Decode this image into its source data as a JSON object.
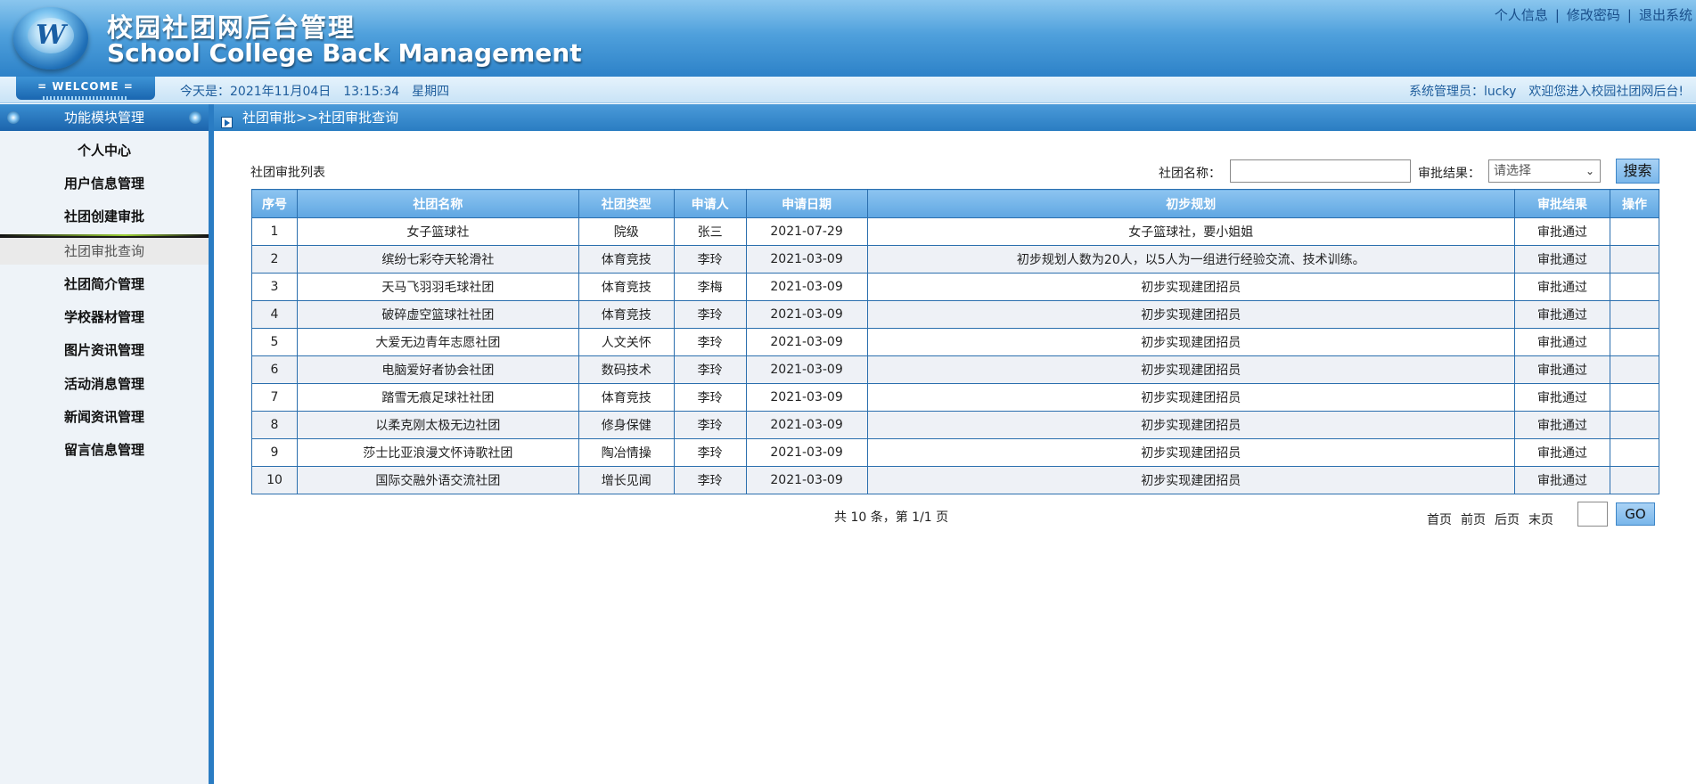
{
  "header": {
    "logo_letter": "W",
    "title_cn": "校园社团网后台管理",
    "title_en": "School College Back Management",
    "links": [
      "个人信息",
      "修改密码",
      "退出系统"
    ]
  },
  "infobar": {
    "welcome": "= WELCOME =",
    "date_label": "今天是：2021年11月04日",
    "time": "13:15:34",
    "weekday": "星期四",
    "admin": "系统管理员：lucky",
    "greeting": "欢迎您进入校园社团网后台!"
  },
  "sidebar": {
    "title": "功能模块管理",
    "items": [
      "个人中心",
      "用户信息管理",
      "社团创建审批",
      "社团审批查询",
      "社团简介管理",
      "学校器材管理",
      "图片资讯管理",
      "活动消息管理",
      "新闻资讯管理",
      "留言信息管理"
    ],
    "active_index": 3
  },
  "breadcrumb": "社团审批>>社团审批查询",
  "list": {
    "title": "社团审批列表",
    "search_name_label": "社团名称：",
    "search_name_value": "",
    "result_label": "审批结果：",
    "result_selected": "请选择",
    "search_button": "搜索",
    "columns": [
      "序号",
      "社团名称",
      "社团类型",
      "申请人",
      "申请日期",
      "初步规划",
      "审批结果",
      "操作"
    ],
    "rows": [
      [
        "1",
        "女子篮球社",
        "院级",
        "张三",
        "2021-07-29",
        "女子篮球社，要小姐姐",
        "审批通过",
        ""
      ],
      [
        "2",
        "缤纷七彩夺天轮滑社",
        "体育竞技",
        "李玲",
        "2021-03-09",
        "初步规划人数为20人，以5人为一组进行经验交流、技术训练。",
        "审批通过",
        ""
      ],
      [
        "3",
        "天马飞羽羽毛球社团",
        "体育竞技",
        "李梅",
        "2021-03-09",
        "初步实现建团招员",
        "审批通过",
        ""
      ],
      [
        "4",
        "破碎虚空篮球社社团",
        "体育竞技",
        "李玲",
        "2021-03-09",
        "初步实现建团招员",
        "审批通过",
        ""
      ],
      [
        "5",
        "大爱无边青年志愿社团",
        "人文关怀",
        "李玲",
        "2021-03-09",
        "初步实现建团招员",
        "审批通过",
        ""
      ],
      [
        "6",
        "电脑爱好者协会社团",
        "数码技术",
        "李玲",
        "2021-03-09",
        "初步实现建团招员",
        "审批通过",
        ""
      ],
      [
        "7",
        "踏雪无痕足球社社团",
        "体育竞技",
        "李玲",
        "2021-03-09",
        "初步实现建团招员",
        "审批通过",
        ""
      ],
      [
        "8",
        "以柔克刚太极无边社团",
        "修身保健",
        "李玲",
        "2021-03-09",
        "初步实现建团招员",
        "审批通过",
        ""
      ],
      [
        "9",
        "莎士比亚浪漫文怀诗歌社团",
        "陶冶情操",
        "李玲",
        "2021-03-09",
        "初步实现建团招员",
        "审批通过",
        ""
      ],
      [
        "10",
        "国际交融外语交流社团",
        "增长见闻",
        "李玲",
        "2021-03-09",
        "初步实现建团招员",
        "审批通过",
        ""
      ]
    ]
  },
  "pager": {
    "summary": "共 10 条，第 1/1 页",
    "first": "首页",
    "prev": "前页",
    "next": "后页",
    "last": "末页",
    "page_value": "",
    "go": "GO"
  }
}
